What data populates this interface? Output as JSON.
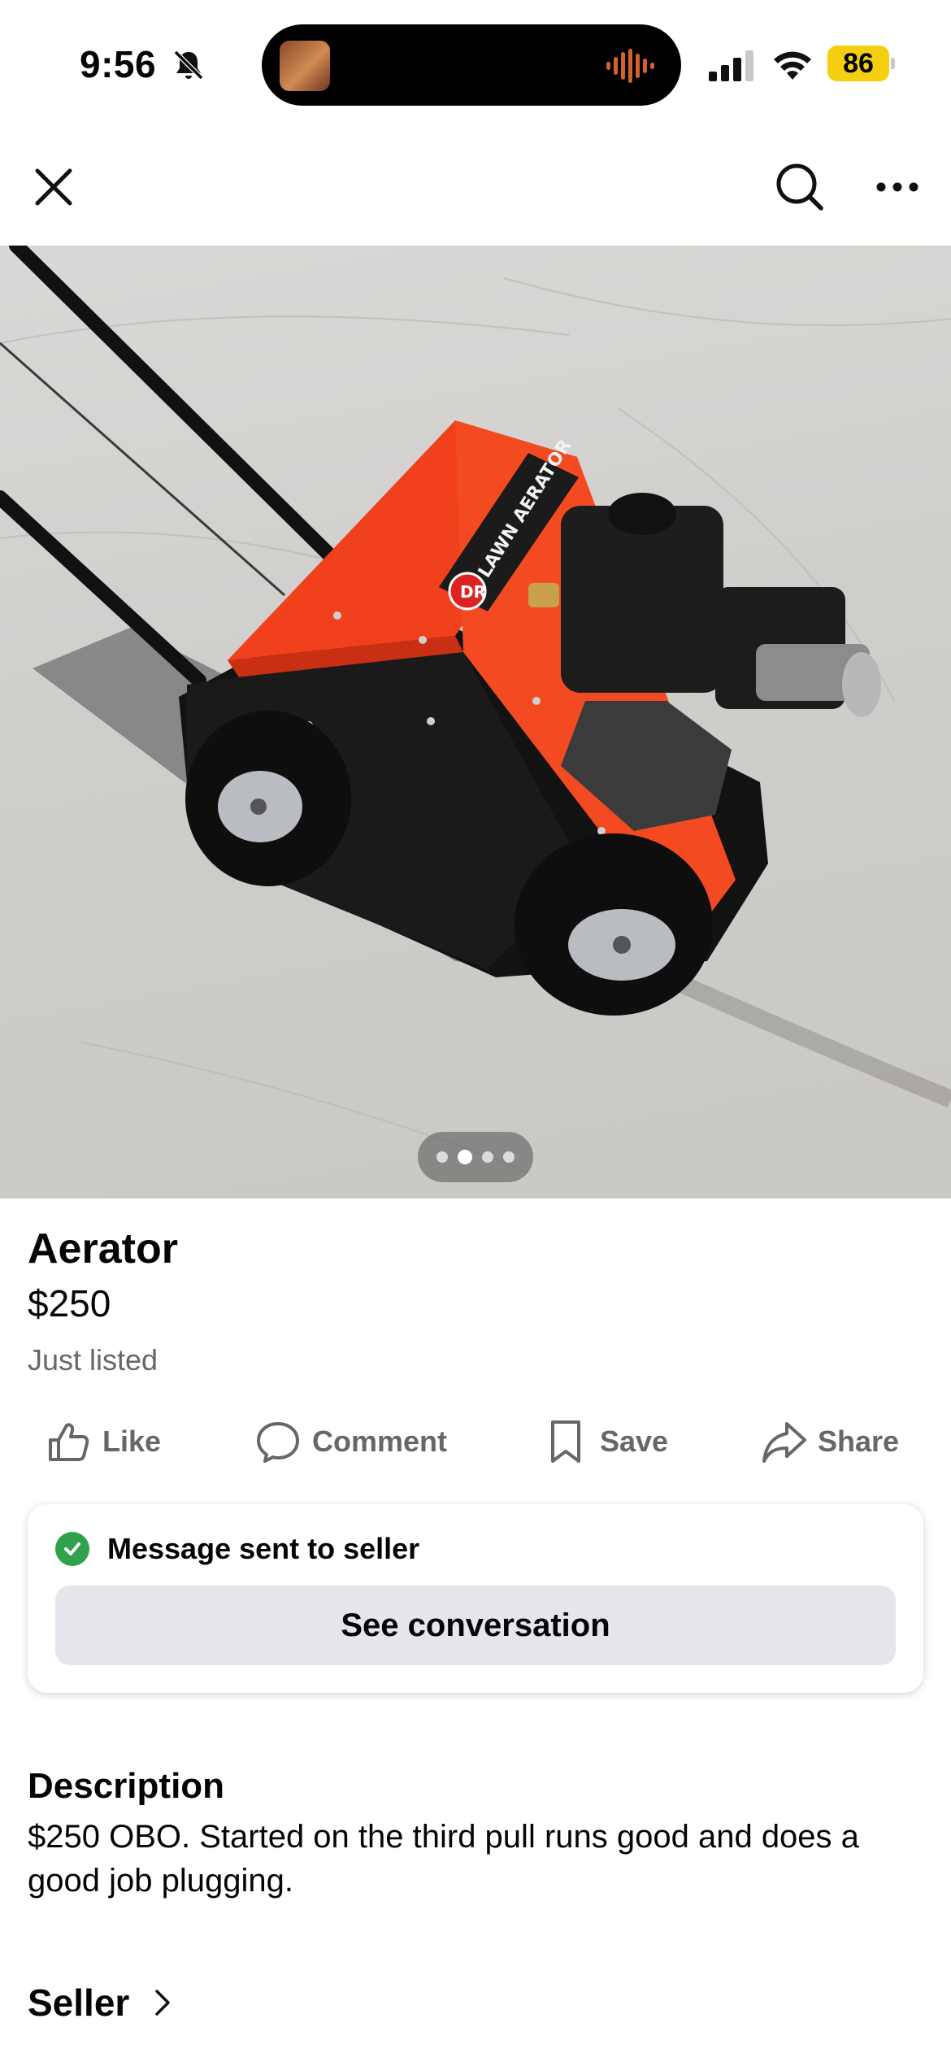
{
  "status_bar": {
    "time": "9:56",
    "battery": "86"
  },
  "icons": {
    "close": "close-icon",
    "search": "search-icon",
    "more": "more-icon",
    "like": "like-icon",
    "comment": "comment-icon",
    "save": "save-icon",
    "share": "share-icon"
  },
  "photo": {
    "stencil": "LAWN AERATOR",
    "logo": "DR",
    "current_index": 2,
    "total": 4
  },
  "listing": {
    "title": "Aerator",
    "price": "$250",
    "listed": "Just listed"
  },
  "actions": [
    {
      "label": "Like"
    },
    {
      "label": "Comment"
    },
    {
      "label": "Save"
    },
    {
      "label": "Share"
    }
  ],
  "message_card": {
    "status": "Message sent to seller",
    "button": "See conversation"
  },
  "description": {
    "heading": "Description",
    "text": "$250 OBO. Started on the third pull runs good and does a good job plugging."
  },
  "seller": {
    "heading": "Seller"
  },
  "colors": {
    "accent_orange": "#f0401c",
    "success": "#31a24c",
    "battery": "#f5cf0f"
  }
}
